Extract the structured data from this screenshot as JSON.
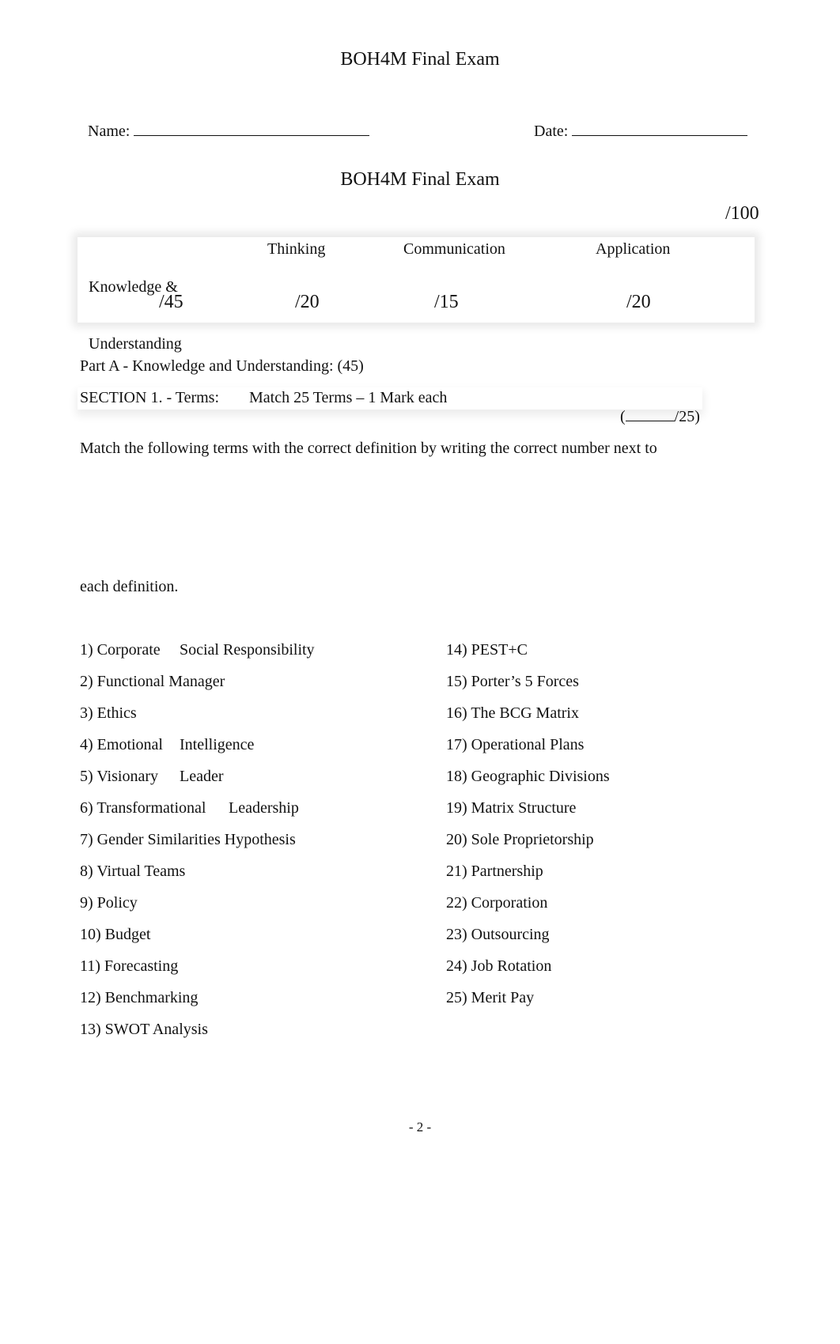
{
  "header": {
    "title": "BOH4M Final Exam",
    "name_label": "Name: ",
    "date_label": "Date: ",
    "subtitle": "BOH4M Final Exam",
    "total": "/100"
  },
  "scores": [
    {
      "category_line1": "Knowledge &",
      "category_line2": "Understanding",
      "max": "/45"
    },
    {
      "category_line1": "Thinking",
      "category_line2": "",
      "max": "/20"
    },
    {
      "category_line1": "Communication",
      "category_line2": "",
      "max": "/15"
    },
    {
      "category_line1": "Application",
      "category_line2": "",
      "max": "/20"
    }
  ],
  "part_a": {
    "heading": "Part A - Knowledge and Understanding: (45)",
    "section_label": "SECTION 1. - Terms:",
    "section_desc": "Match 25 Terms – 1 Mark each",
    "section_score_open": "(",
    "section_score_close": "/25)",
    "instruction_line1": "Match the following terms with the correct definition by writing the correct number next to",
    "instruction_line2": "each definition."
  },
  "terms_left": [
    {
      "num": "1)",
      "text": "Corporate",
      "text2": "Social Responsibility"
    },
    {
      "num": "2)",
      "text": "Functional Manager",
      "text2": ""
    },
    {
      "num": "3)",
      "text": "Ethics",
      "text2": ""
    },
    {
      "num": "4)",
      "text": "Emotional",
      "text2": "Intelligence"
    },
    {
      "num": "5)",
      "text": "Visionary",
      "text2": "Leader"
    },
    {
      "num": "6)",
      "text": "Transformational",
      "text2": "Leadership"
    },
    {
      "num": "7)",
      "text": "Gender Similarities Hypothesis",
      "text2": ""
    },
    {
      "num": "8)",
      "text": "Virtual Teams",
      "text2": ""
    },
    {
      "num": "9)",
      "text": "Policy",
      "text2": ""
    },
    {
      "num": "10)",
      "text": "Budget",
      "text2": ""
    },
    {
      "num": "11)",
      "text": "Forecasting",
      "text2": ""
    },
    {
      "num": "12)",
      "text": "Benchmarking",
      "text2": ""
    },
    {
      "num": "13)",
      "text": "SWOT Analysis",
      "text2": ""
    }
  ],
  "terms_right": [
    {
      "num": "14)",
      "text": "PEST+C"
    },
    {
      "num": "15)",
      "text": "Porter’s 5 Forces"
    },
    {
      "num": "16)",
      "text": "The BCG Matrix"
    },
    {
      "num": "17)",
      "text": "Operational Plans"
    },
    {
      "num": "18)",
      "text": "Geographic Divisions"
    },
    {
      "num": "19)",
      "text": "Matrix Structure"
    },
    {
      "num": "20)",
      "text": "Sole Proprietorship"
    },
    {
      "num": "21)",
      "text": "Partnership"
    },
    {
      "num": "22)",
      "text": "Corporation"
    },
    {
      "num": "23)",
      "text": "Outsourcing"
    },
    {
      "num": "24)",
      "text": "Job Rotation"
    },
    {
      "num": "25)",
      "text": "Merit Pay"
    }
  ],
  "footer": {
    "page_number": "- 2 -"
  }
}
